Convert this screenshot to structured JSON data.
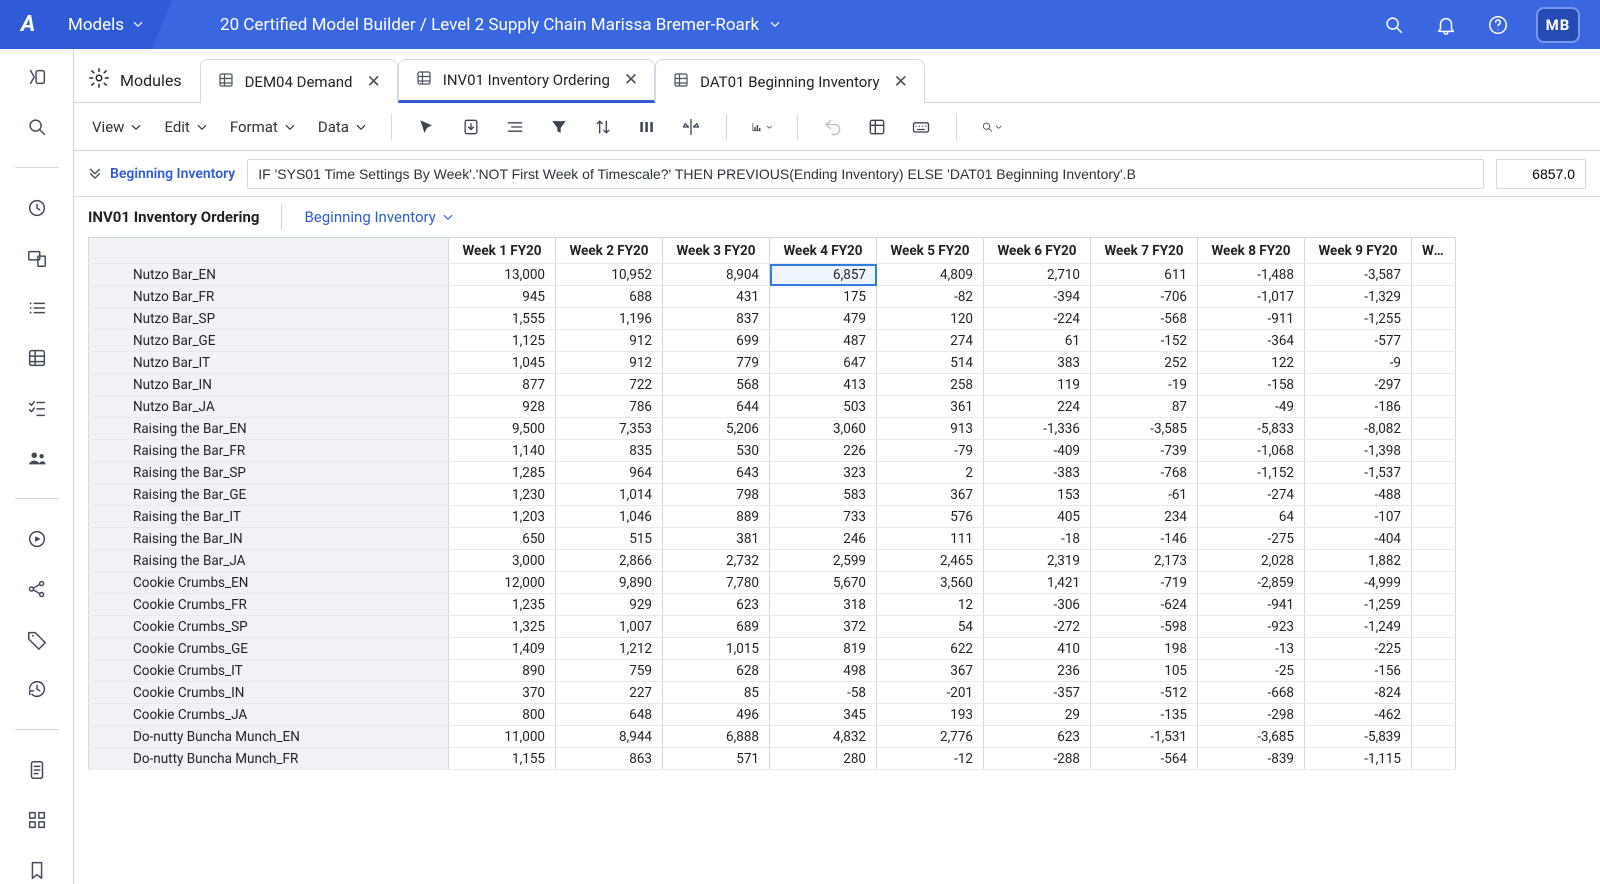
{
  "ribbon": {
    "logo_text": "A",
    "models_label": "Models",
    "breadcrumb": "20 Certified Model Builder / Level 2 Supply Chain Marissa Bremer-Roark",
    "avatar_initials": "MB"
  },
  "tabs": {
    "modules_label": "Modules",
    "items": [
      {
        "label": "DEM04 Demand",
        "active": false
      },
      {
        "label": "INV01 Inventory Ordering",
        "active": true
      },
      {
        "label": "DAT01 Beginning Inventory",
        "active": false
      }
    ]
  },
  "toolbar": {
    "view": "View",
    "edit": "Edit",
    "format": "Format",
    "data": "Data"
  },
  "formulabar": {
    "lineitem": "Beginning Inventory",
    "formula": "IF 'SYS01 Time Settings By Week'.'NOT First Week of Timescale?' THEN PREVIOUS(Ending Inventory) ELSE 'DAT01 Beginning Inventory'.B",
    "value": "6857.0"
  },
  "pagesel": {
    "module": "INV01 Inventory Ordering",
    "picker": "Beginning Inventory"
  },
  "grid": {
    "columns": [
      "Week 1 FY20",
      "Week 2 FY20",
      "Week 3 FY20",
      "Week 4 FY20",
      "Week 5 FY20",
      "Week 6 FY20",
      "Week 7 FY20",
      "Week 8 FY20",
      "Week 9 FY20"
    ],
    "trailing_col": "Wee",
    "selected": {
      "row": 0,
      "col": 3
    },
    "dropdown_col": 1,
    "rows": [
      {
        "name": "Nutzo Bar_EN",
        "v": [
          "13,000",
          "10,952",
          "8,904",
          "6,857",
          "4,809",
          "2,710",
          "611",
          "-1,488",
          "-3,587"
        ],
        "hl": true
      },
      {
        "name": "Nutzo Bar_FR",
        "v": [
          "945",
          "688",
          "431",
          "175",
          "-82",
          "-394",
          "-706",
          "-1,017",
          "-1,329"
        ]
      },
      {
        "name": "Nutzo Bar_SP",
        "v": [
          "1,555",
          "1,196",
          "837",
          "479",
          "120",
          "-224",
          "-568",
          "-911",
          "-1,255"
        ]
      },
      {
        "name": "Nutzo Bar_GE",
        "v": [
          "1,125",
          "912",
          "699",
          "487",
          "274",
          "61",
          "-152",
          "-364",
          "-577"
        ]
      },
      {
        "name": "Nutzo Bar_IT",
        "v": [
          "1,045",
          "912",
          "779",
          "647",
          "514",
          "383",
          "252",
          "122",
          "-9"
        ]
      },
      {
        "name": "Nutzo Bar_IN",
        "v": [
          "877",
          "722",
          "568",
          "413",
          "258",
          "119",
          "-19",
          "-158",
          "-297"
        ]
      },
      {
        "name": "Nutzo Bar_JA",
        "v": [
          "928",
          "786",
          "644",
          "503",
          "361",
          "224",
          "87",
          "-49",
          "-186"
        ]
      },
      {
        "name": "Raising the Bar_EN",
        "v": [
          "9,500",
          "7,353",
          "5,206",
          "3,060",
          "913",
          "-1,336",
          "-3,585",
          "-5,833",
          "-8,082"
        ]
      },
      {
        "name": "Raising the Bar_FR",
        "v": [
          "1,140",
          "835",
          "530",
          "226",
          "-79",
          "-409",
          "-739",
          "-1,068",
          "-1,398"
        ]
      },
      {
        "name": "Raising the Bar_SP",
        "v": [
          "1,285",
          "964",
          "643",
          "323",
          "2",
          "-383",
          "-768",
          "-1,152",
          "-1,537"
        ]
      },
      {
        "name": "Raising the Bar_GE",
        "v": [
          "1,230",
          "1,014",
          "798",
          "583",
          "367",
          "153",
          "-61",
          "-274",
          "-488"
        ]
      },
      {
        "name": "Raising the Bar_IT",
        "v": [
          "1,203",
          "1,046",
          "889",
          "733",
          "576",
          "405",
          "234",
          "64",
          "-107"
        ]
      },
      {
        "name": "Raising the Bar_IN",
        "v": [
          "650",
          "515",
          "381",
          "246",
          "111",
          "-18",
          "-146",
          "-275",
          "-404"
        ]
      },
      {
        "name": "Raising the Bar_JA",
        "v": [
          "3,000",
          "2,866",
          "2,732",
          "2,599",
          "2,465",
          "2,319",
          "2,173",
          "2,028",
          "1,882"
        ]
      },
      {
        "name": "Cookie Crumbs_EN",
        "v": [
          "12,000",
          "9,890",
          "7,780",
          "5,670",
          "3,560",
          "1,421",
          "-719",
          "-2,859",
          "-4,999"
        ]
      },
      {
        "name": "Cookie Crumbs_FR",
        "v": [
          "1,235",
          "929",
          "623",
          "318",
          "12",
          "-306",
          "-624",
          "-941",
          "-1,259"
        ]
      },
      {
        "name": "Cookie Crumbs_SP",
        "v": [
          "1,325",
          "1,007",
          "689",
          "372",
          "54",
          "-272",
          "-598",
          "-923",
          "-1,249"
        ]
      },
      {
        "name": "Cookie Crumbs_GE",
        "v": [
          "1,409",
          "1,212",
          "1,015",
          "819",
          "622",
          "410",
          "198",
          "-13",
          "-225"
        ]
      },
      {
        "name": "Cookie Crumbs_IT",
        "v": [
          "890",
          "759",
          "628",
          "498",
          "367",
          "236",
          "105",
          "-25",
          "-156"
        ]
      },
      {
        "name": "Cookie Crumbs_IN",
        "v": [
          "370",
          "227",
          "85",
          "-58",
          "-201",
          "-357",
          "-512",
          "-668",
          "-824"
        ]
      },
      {
        "name": "Cookie Crumbs_JA",
        "v": [
          "800",
          "648",
          "496",
          "345",
          "193",
          "29",
          "-135",
          "-298",
          "-462"
        ]
      },
      {
        "name": "Do-nutty Buncha Munch_EN",
        "v": [
          "11,000",
          "8,944",
          "6,888",
          "4,832",
          "2,776",
          "623",
          "-1,531",
          "-3,685",
          "-5,839"
        ]
      },
      {
        "name": "Do-nutty Buncha Munch_FR",
        "v": [
          "1,155",
          "863",
          "571",
          "280",
          "-12",
          "-288",
          "-564",
          "-839",
          "-1,115"
        ]
      }
    ]
  }
}
